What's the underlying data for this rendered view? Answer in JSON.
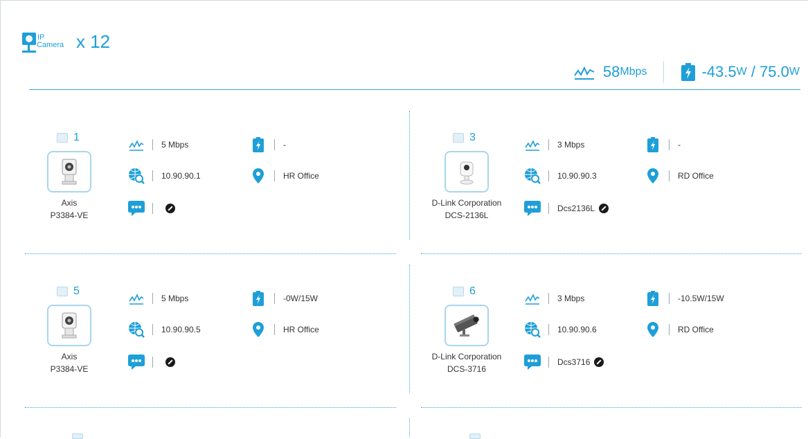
{
  "header": {
    "logo_ip": "IP",
    "logo_camera": "Camera",
    "camera_count": "x 12"
  },
  "summary": {
    "bandwidth_value": "58",
    "bandwidth_unit": "Mbps",
    "power_value": "-43.5",
    "power_unit_1": "W",
    "power_sep": " / ",
    "power_budget": "75.0",
    "power_unit_2": "W"
  },
  "colors": {
    "accent": "#1e9fd8",
    "divider": "#3aa6d6"
  },
  "icons": [
    "ip-camera-icon",
    "pulse-icon",
    "battery-bolt-icon",
    "globe-search-icon",
    "location-pin-icon",
    "chat-bubble-icon",
    "edit-icon"
  ],
  "devices": [
    {
      "num": "1",
      "vendor": "Axis",
      "model": "P3384-VE",
      "bandwidth": "5 Mbps",
      "power": "-",
      "ip": "10.90.90.1",
      "location": "HR Office",
      "note": ""
    },
    {
      "num": "3",
      "vendor": "D-Link Corporation",
      "model": "DCS-2136L",
      "bandwidth": "3 Mbps",
      "power": "-",
      "ip": "10.90.90.3",
      "location": "RD Office",
      "note": "Dcs2136L"
    },
    {
      "num": "5",
      "vendor": "Axis",
      "model": "P3384-VE",
      "bandwidth": "5 Mbps",
      "power": "-0W/15W",
      "ip": "10.90.90.5",
      "location": "HR Office",
      "note": ""
    },
    {
      "num": "6",
      "vendor": "D-Link Corporation",
      "model": "DCS-3716",
      "bandwidth": "3 Mbps",
      "power": "-10.5W/15W",
      "ip": "10.90.90.6",
      "location": "RD Office",
      "note": "Dcs3716"
    }
  ]
}
